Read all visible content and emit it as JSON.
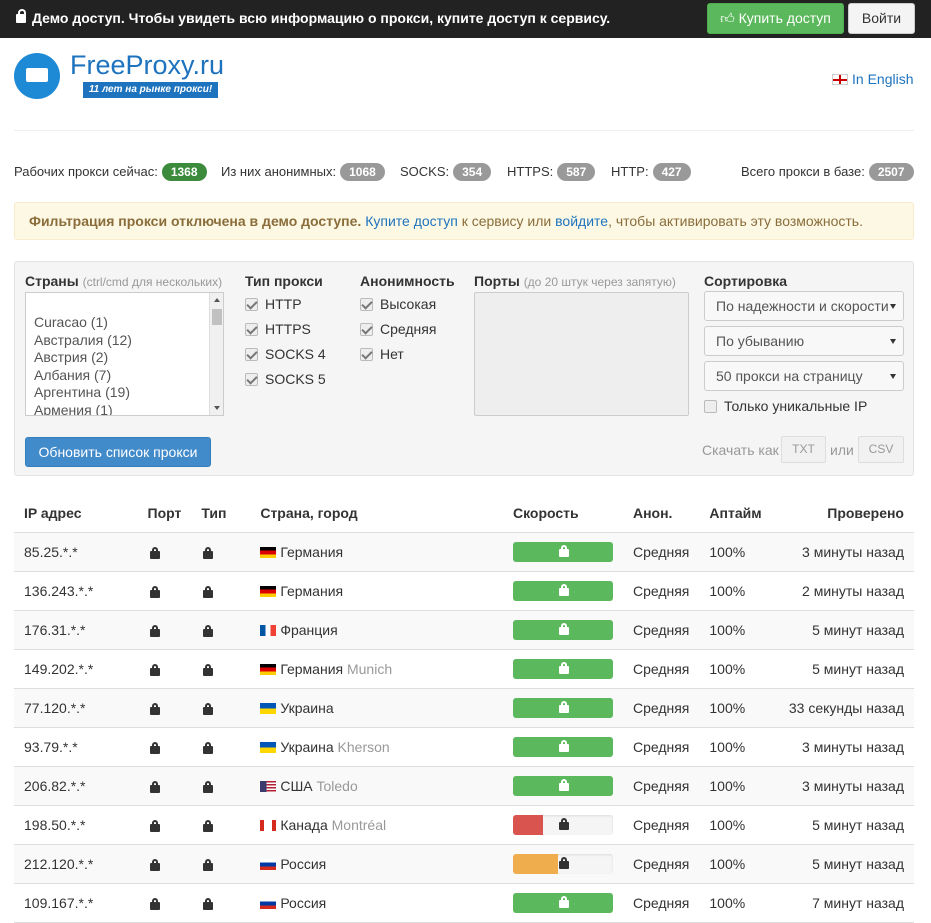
{
  "topbar": {
    "message": "Демо доступ. Чтобы увидеть всю информацию о прокси, купите доступ к сервису.",
    "buy_label": "Купить доступ",
    "login_label": "Войти"
  },
  "logo": {
    "name": "FreeProxy",
    "tld": ".ru",
    "ribbon": "11 лет на рынке прокси!"
  },
  "lang": {
    "label": "In English"
  },
  "stats": {
    "working_label": "Рабочих прокси сейчас:",
    "working": "1368",
    "anon_label": "Из них анонимных:",
    "anon": "1068",
    "socks_label": "SOCKS:",
    "socks": "354",
    "https_label": "HTTPS:",
    "https": "587",
    "http_label": "HTTP:",
    "http": "427",
    "total_label": "Всего прокси в базе:",
    "total": "2507"
  },
  "alert": {
    "bold": "Фильтрация прокси отключена в демо доступе.",
    "link1": "Купите доступ",
    "mid": " к сервису или ",
    "link2": "войдите",
    "tail": ", чтобы активировать эту возможность."
  },
  "filter": {
    "countries_label": "Страны",
    "countries_hint": "(ctrl/cmd для нескольких)",
    "countries": [
      "Curacao (1)",
      "Австралия (12)",
      "Австрия (2)",
      "Албания (7)",
      "Аргентина (19)",
      "Армения (1)"
    ],
    "type_label": "Тип прокси",
    "types": [
      "HTTP",
      "HTTPS",
      "SOCKS 4",
      "SOCKS 5"
    ],
    "anon_label": "Анонимность",
    "anon_levels": [
      "Высокая",
      "Средняя",
      "Нет"
    ],
    "ports_label": "Порты",
    "ports_hint": "(до 20 штук через запятую)",
    "sort_label": "Сортировка",
    "sort_by": "По надежности и скорости",
    "sort_order": "По убыванию",
    "per_page": "50 прокси на страницу",
    "unique_label": "Только уникальные IP",
    "update_label": "Обновить список прокси",
    "download_label": "Скачать как",
    "txt": "TXT",
    "or": "или",
    "csv": "CSV"
  },
  "table": {
    "headers": {
      "ip": "IP адрес",
      "port": "Порт",
      "type": "Тип",
      "country": "Страна, город",
      "speed": "Скорость",
      "anon": "Анон.",
      "uptime": "Аптайм",
      "checked": "Проверено"
    },
    "rows": [
      {
        "ip": "85.25.*.*",
        "country": "Германия",
        "city": "",
        "flag": "de",
        "speed": 1.0,
        "speed_color": "#5cb85c",
        "anon": "Средняя",
        "uptime": "100%",
        "checked": "3 минуты назад"
      },
      {
        "ip": "136.243.*.*",
        "country": "Германия",
        "city": "",
        "flag": "de",
        "speed": 1.0,
        "speed_color": "#5cb85c",
        "anon": "Средняя",
        "uptime": "100%",
        "checked": "2 минуты назад"
      },
      {
        "ip": "176.31.*.*",
        "country": "Франция",
        "city": "",
        "flag": "fr",
        "speed": 1.0,
        "speed_color": "#5cb85c",
        "anon": "Средняя",
        "uptime": "100%",
        "checked": "5 минут назад"
      },
      {
        "ip": "149.202.*.*",
        "country": "Германия",
        "city": "Munich",
        "flag": "de",
        "speed": 1.0,
        "speed_color": "#5cb85c",
        "anon": "Средняя",
        "uptime": "100%",
        "checked": "5 минут назад"
      },
      {
        "ip": "77.120.*.*",
        "country": "Украина",
        "city": "",
        "flag": "ua",
        "speed": 1.0,
        "speed_color": "#5cb85c",
        "anon": "Средняя",
        "uptime": "100%",
        "checked": "33 секунды назад"
      },
      {
        "ip": "93.79.*.*",
        "country": "Украина",
        "city": "Kherson",
        "flag": "ua",
        "speed": 1.0,
        "speed_color": "#5cb85c",
        "anon": "Средняя",
        "uptime": "100%",
        "checked": "3 минуты назад"
      },
      {
        "ip": "206.82.*.*",
        "country": "США",
        "city": "Toledo",
        "flag": "us",
        "speed": 1.0,
        "speed_color": "#5cb85c",
        "anon": "Средняя",
        "uptime": "100%",
        "checked": "3 минуты назад"
      },
      {
        "ip": "198.50.*.*",
        "country": "Канада",
        "city": "Montréal",
        "flag": "ca",
        "speed": 0.3,
        "speed_color": "#d9534f",
        "anon": "Средняя",
        "uptime": "100%",
        "checked": "5 минут назад"
      },
      {
        "ip": "212.120.*.*",
        "country": "Россия",
        "city": "",
        "flag": "ru",
        "speed": 0.45,
        "speed_color": "#f0ad4e",
        "anon": "Средняя",
        "uptime": "100%",
        "checked": "5 минут назад"
      },
      {
        "ip": "109.167.*.*",
        "country": "Россия",
        "city": "",
        "flag": "ru",
        "speed": 1.0,
        "speed_color": "#5cb85c",
        "anon": "Средняя",
        "uptime": "100%",
        "checked": "7 минут назад"
      }
    ]
  }
}
